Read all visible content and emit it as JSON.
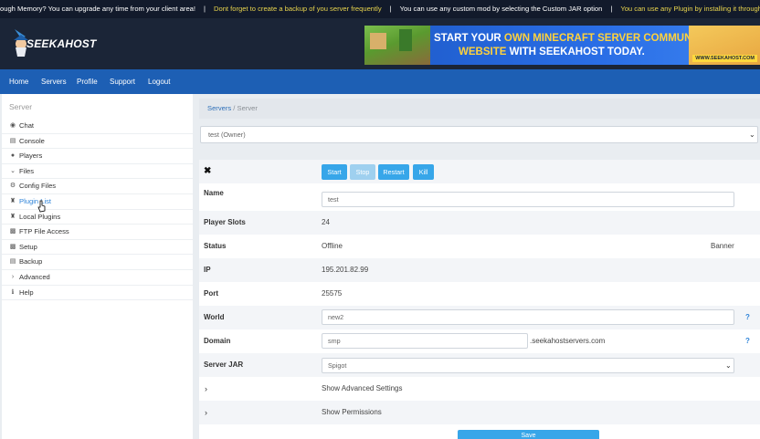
{
  "ticker": {
    "msg1": "ough Memory? You can upgrade any time from your client area!",
    "msg2": "Dont forget to create a backup of you server frequently",
    "msg3": "You can use any custom mod by selecting the Custom JAR option",
    "msg4": "You can use any Plugin by installing it through the plugin"
  },
  "brand": {
    "logo_text": "SEEKAHOST",
    "banner_line1_a": "START YOUR ",
    "banner_line1_b": "OWN MINECRAFT SERVER COMMUNITY",
    "banner_line2_a": "WEBSITE ",
    "banner_line2_b": "WITH SEEKAHOST TODAY.",
    "banner_url": "WWW.SEEKAHOST.COM"
  },
  "nav": [
    "Home",
    "Servers",
    "Profile",
    "Support",
    "Logout"
  ],
  "sidebar": {
    "heading": "Server",
    "items": [
      {
        "label": "Chat",
        "icon": "chat-icon"
      },
      {
        "label": "Console",
        "icon": "console-icon"
      },
      {
        "label": "Players",
        "icon": "players-icon"
      },
      {
        "label": "Files",
        "icon": "chevron-down-icon"
      },
      {
        "label": "Config Files",
        "icon": "gear-icon"
      },
      {
        "label": "Plugin List",
        "icon": "plugin-icon"
      },
      {
        "label": "Local Plugins",
        "icon": "plugin-icon"
      },
      {
        "label": "FTP File Access",
        "icon": "file-icon"
      },
      {
        "label": "Setup",
        "icon": "file-icon"
      },
      {
        "label": "Backup",
        "icon": "backup-icon"
      },
      {
        "label": "Advanced",
        "icon": "chevron-right-icon"
      },
      {
        "label": "Help",
        "icon": "info-icon"
      }
    ]
  },
  "breadcrumb": {
    "link": "Servers",
    "separator": "/",
    "current": "Server"
  },
  "server_select": {
    "value": "test (Owner)"
  },
  "controls": {
    "start": "Start",
    "stop": "Stop",
    "restart": "Restart",
    "kill": "Kill"
  },
  "details": {
    "name_label": "Name",
    "name_value": "test",
    "slots_label": "Player Slots",
    "slots_value": "24",
    "status_label": "Status",
    "status_value": "Offline",
    "status_extra": "Banner",
    "ip_label": "IP",
    "ip_value": "195.201.82.99",
    "port_label": "Port",
    "port_value": "25575",
    "world_label": "World",
    "world_value": "new2",
    "domain_label": "Domain",
    "domain_value": "smp",
    "domain_suffix": ".seekahostservers.com",
    "jar_label": "Server JAR",
    "jar_value": "Spigot",
    "help_mark": "?"
  },
  "expanders": {
    "advanced": "Show Advanced Settings",
    "permissions": "Show Permissions"
  },
  "save_label": "Save",
  "colors": {
    "nav": "#1d5fb4",
    "button": "#37a6e9",
    "active_link": "#2e83d8",
    "ticker_bg": "#121a2b",
    "ticker_highlight": "#e8d44d"
  }
}
